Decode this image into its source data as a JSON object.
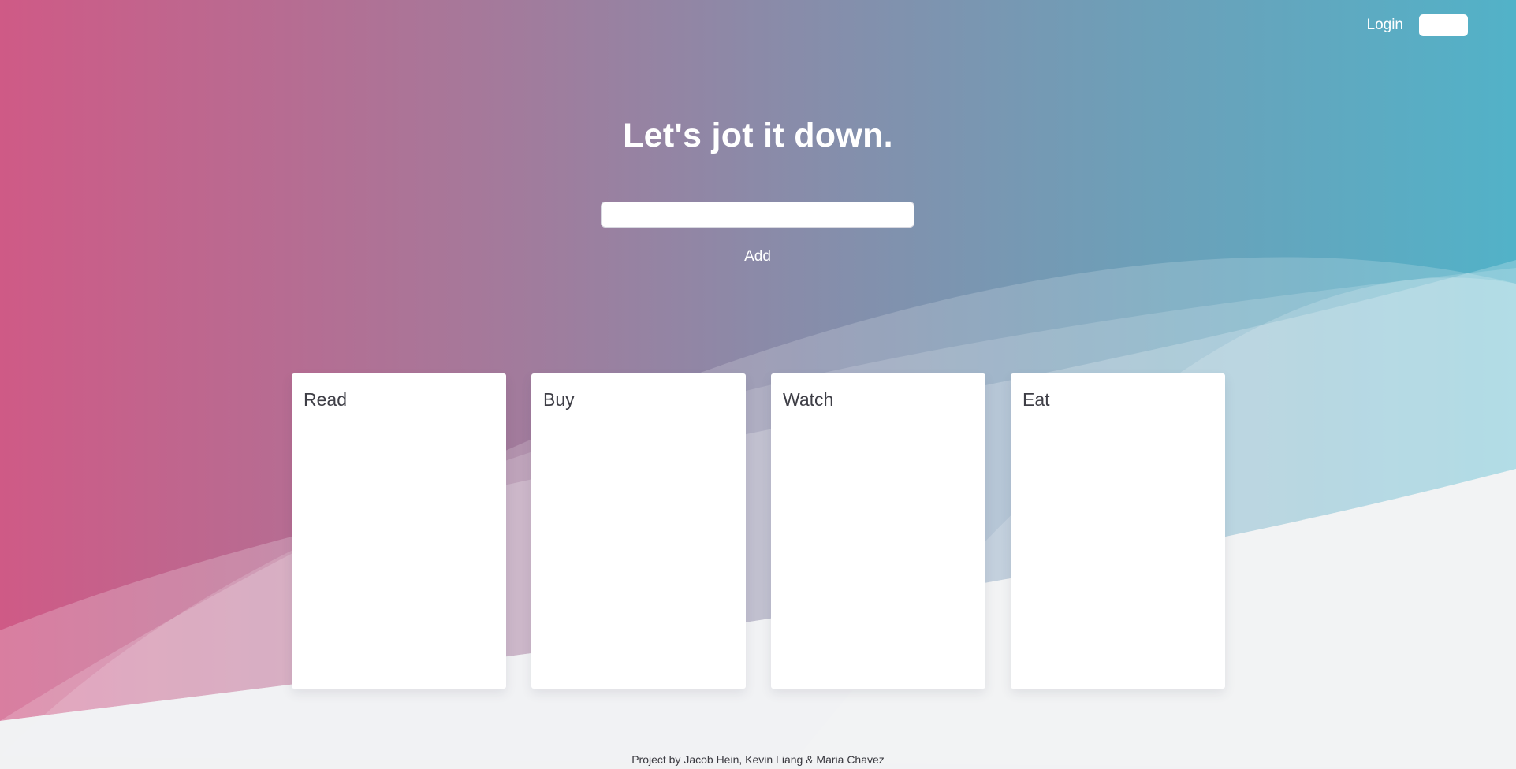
{
  "nav": {
    "login_label": "Login",
    "button_label": ""
  },
  "hero": {
    "title": "Let's jot it down."
  },
  "entry": {
    "input_value": "",
    "input_placeholder": "",
    "add_label": "Add"
  },
  "cards": [
    {
      "title": "Read"
    },
    {
      "title": "Buy"
    },
    {
      "title": "Watch"
    },
    {
      "title": "Eat"
    }
  ],
  "footer": {
    "credits": "Project by Jacob Hein, Kevin Liang & Maria Chavez"
  },
  "colors": {
    "gradient_left": "#cf5a86",
    "gradient_right": "#52b2c8",
    "page_bottom": "#eff0f2",
    "card_background": "#ffffff"
  }
}
